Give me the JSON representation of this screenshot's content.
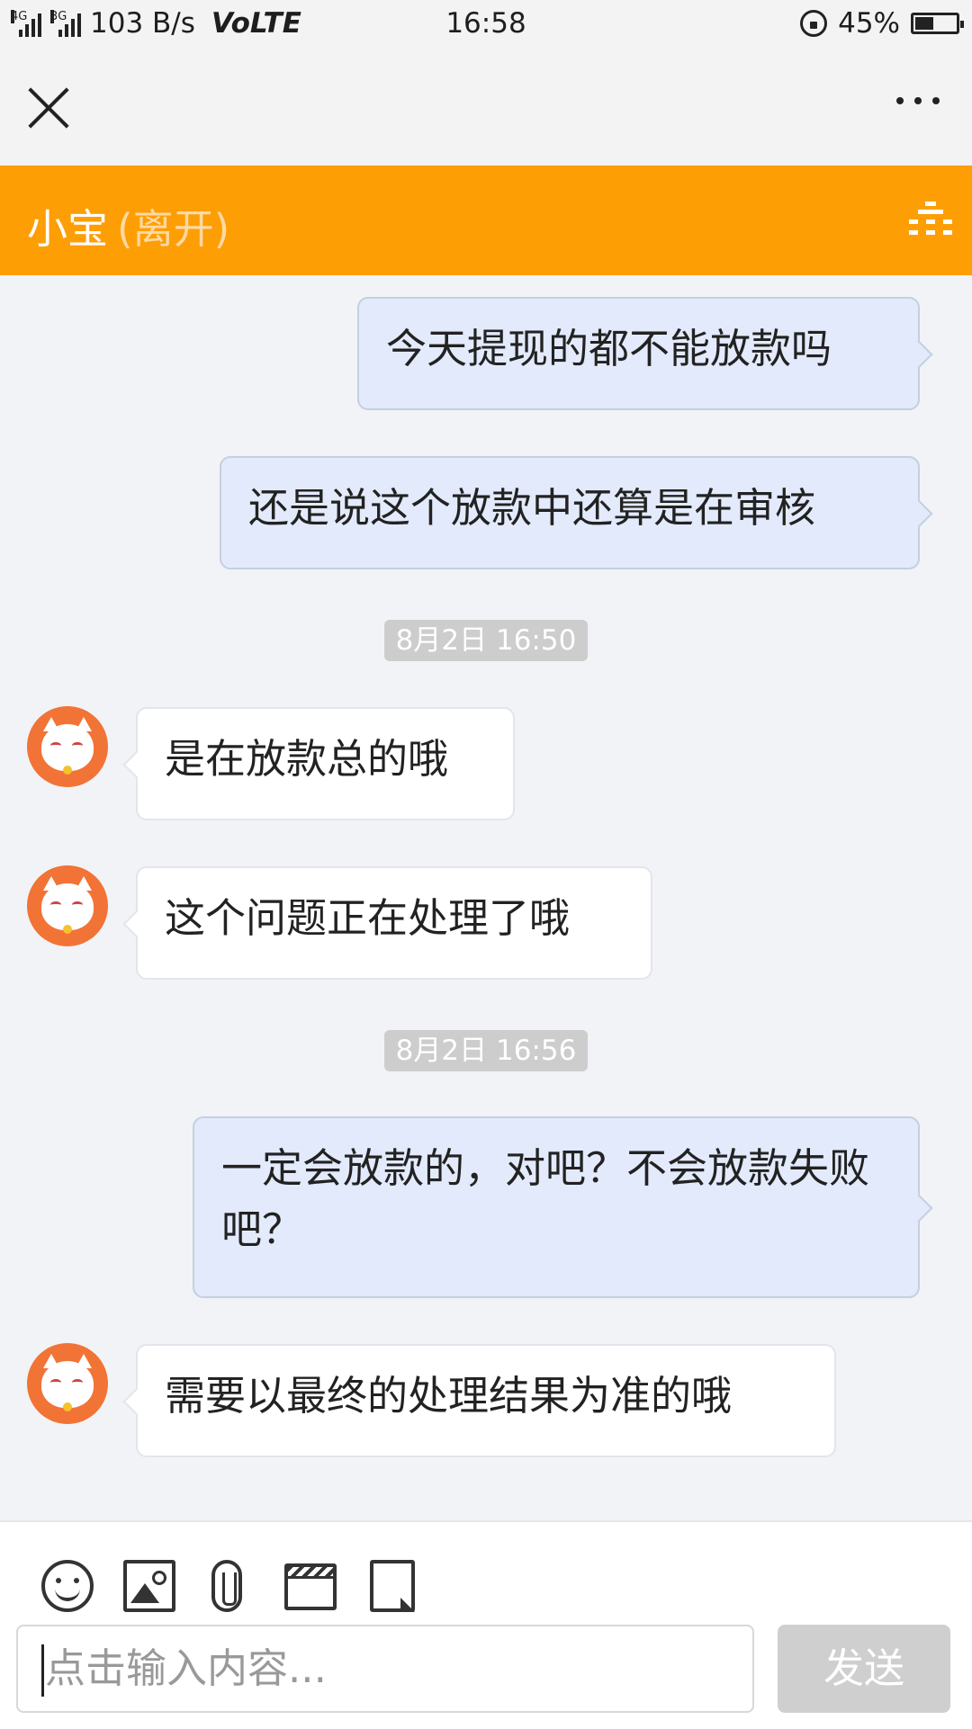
{
  "status_bar": {
    "network_tag_1": "4G",
    "network_tag_2": "3G",
    "speed": "103 B/s",
    "volte": "VoLTE",
    "time": "16:58",
    "battery": "45%",
    "battery_level": 0.45
  },
  "header": {
    "agent_name": "小宝",
    "agent_status": "(离开)",
    "accent_color": "#fe9e05"
  },
  "messages": [
    {
      "side": "out",
      "text": "今天提现的都不能放款吗"
    },
    {
      "side": "out",
      "text": "还是说这个放款中还算是在审核"
    },
    {
      "type": "timestamp",
      "text": "8月2日 16:50"
    },
    {
      "side": "in",
      "text": "是在放款总的哦"
    },
    {
      "side": "in",
      "text": "这个问题正在处理了哦"
    },
    {
      "type": "timestamp",
      "text": "8月2日 16:56"
    },
    {
      "side": "out",
      "text": "一定会放款的，对吧？不会放款失败吧？"
    },
    {
      "side": "in",
      "text": "需要以最终的处理结果为准的哦"
    }
  ],
  "toolbar": {
    "icons": [
      "emoji-icon",
      "image-icon",
      "attachment-icon",
      "video-icon",
      "note-icon"
    ]
  },
  "input": {
    "placeholder": "点击输入内容...",
    "send_label": "发送"
  }
}
